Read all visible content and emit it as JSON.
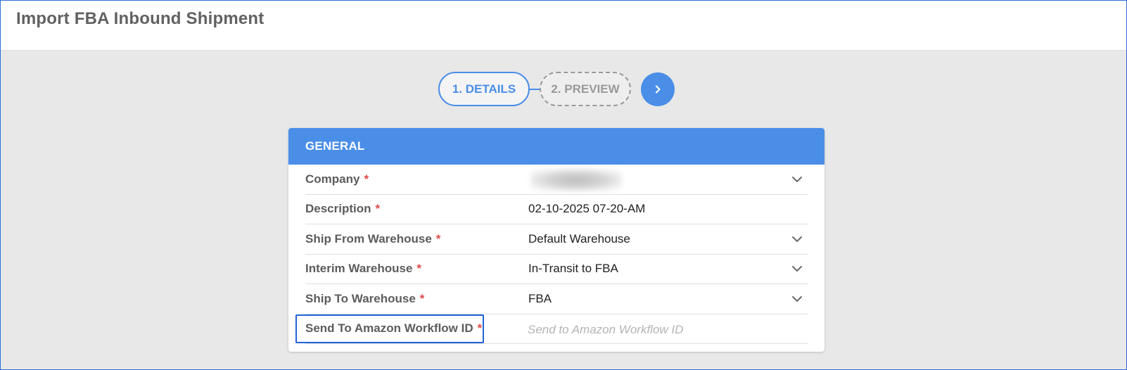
{
  "page": {
    "title": "Import FBA Inbound Shipment"
  },
  "stepper": {
    "steps": [
      {
        "label": "1. DETAILS",
        "state": "active"
      },
      {
        "label": "2. PREVIEW",
        "state": "inactive"
      }
    ],
    "next_icon": "chevron-right-icon"
  },
  "general": {
    "header": "GENERAL",
    "required_mark": "*",
    "rows": [
      {
        "label": "Company",
        "value": "",
        "control": "select"
      },
      {
        "label": "Description",
        "value": "02-10-2025 07-20-AM",
        "control": "text"
      },
      {
        "label": "Ship From Warehouse",
        "value": "Default Warehouse",
        "control": "select"
      },
      {
        "label": "Interim Warehouse",
        "value": "In-Transit to FBA",
        "control": "select"
      },
      {
        "label": "Ship To Warehouse",
        "value": "FBA",
        "control": "select"
      },
      {
        "label": "Send To Amazon Workflow ID",
        "value": "",
        "placeholder": "Send to Amazon Workflow ID",
        "control": "input"
      }
    ]
  },
  "colors": {
    "accent": "#4a8ee8",
    "required": "#e04a4a",
    "highlight": "#2064d8"
  }
}
